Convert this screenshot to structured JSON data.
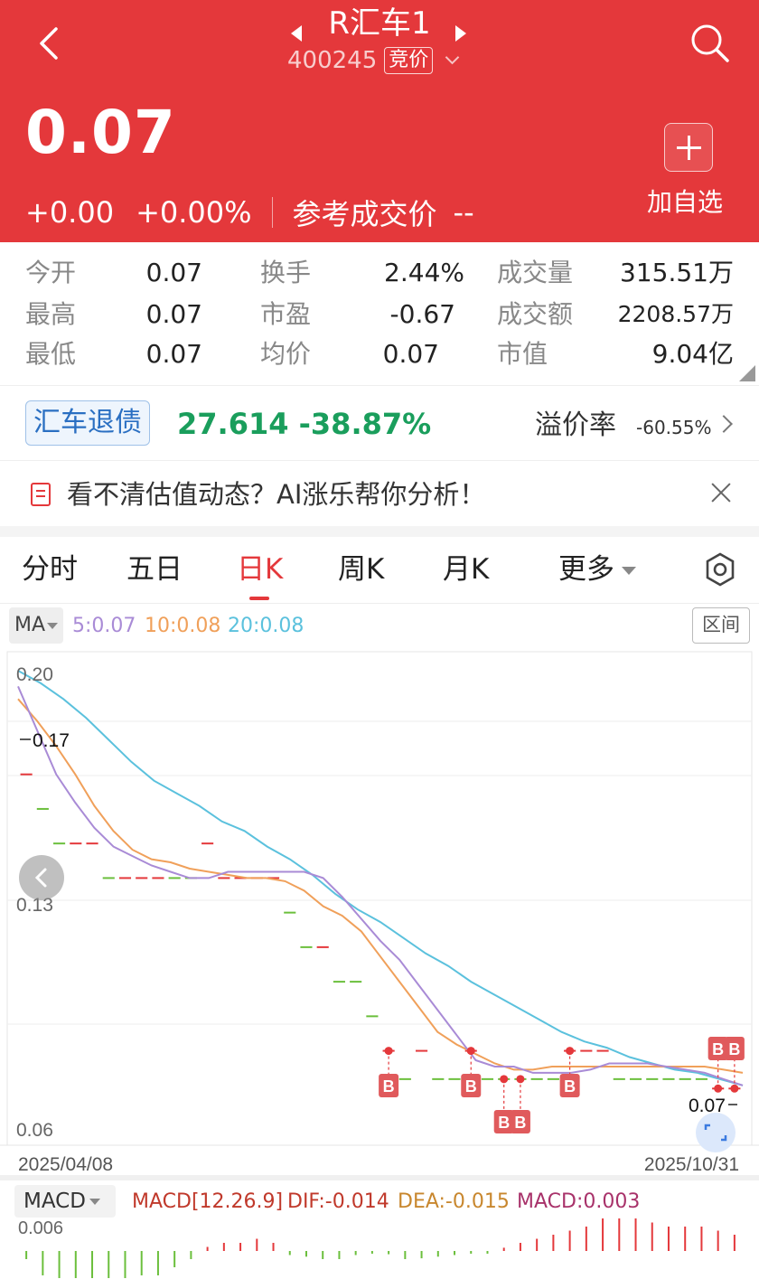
{
  "header": {
    "name": "R汇车1",
    "code": "400245",
    "code_tag": "竞价",
    "price": "0.07",
    "change": "+0.00",
    "change_pct": "+0.00%",
    "ref_label": "参考成交价",
    "ref_value": "--",
    "add_label": "加自选"
  },
  "stats": [
    {
      "label": "今开",
      "value": "0.07"
    },
    {
      "label": "换手",
      "value": "2.44%"
    },
    {
      "label": "成交量",
      "value": "315.51万"
    },
    {
      "label": "最高",
      "value": "0.07"
    },
    {
      "label": "市盈",
      "value": "-0.67"
    },
    {
      "label": "成交额",
      "value": "2208.57万"
    },
    {
      "label": "最低",
      "value": "0.07"
    },
    {
      "label": "均价",
      "value": "0.07"
    },
    {
      "label": "市值",
      "value": "9.04亿"
    }
  ],
  "bond": {
    "tag": "汇车退债",
    "value": "27.614 -38.87%",
    "premium_label": "溢价率",
    "premium_value": "-60.55%"
  },
  "ai_banner": {
    "text": "看不清估值动态？AI涨乐帮你分析！"
  },
  "tabs": [
    {
      "label": "分时"
    },
    {
      "label": "五日"
    },
    {
      "label": "日K"
    },
    {
      "label": "周K"
    },
    {
      "label": "月K"
    },
    {
      "label": "更多"
    }
  ],
  "active_tab": "日K",
  "ma_bar": {
    "button": "MA",
    "ma5": "5:0.07",
    "ma10": "10:0.08",
    "ma20": "20:0.08",
    "range_button": "区间"
  },
  "colors": {
    "header_red": "#e4383b",
    "ma5": "#a98bd6",
    "ma10": "#f0a05a",
    "ma20": "#5bc1dd",
    "up": "#e4383b",
    "down": "#6bbf3c",
    "bond_green": "#1a9e5c"
  },
  "chart_data": {
    "type": "candlestick",
    "y_ticks": [
      "0.20",
      "0.13",
      "0.06"
    ],
    "ylim": [
      0.06,
      0.205
    ],
    "x_start_label": "2025/04/08",
    "x_end_label": "2025/10/31",
    "max_label": "0.17",
    "min_label": "0.07",
    "candles": [
      {
        "price": 0.172,
        "dir": "up"
      },
      {
        "price": 0.161,
        "dir": "down"
      },
      {
        "price": 0.15,
        "dir": "down"
      },
      {
        "price": 0.15,
        "dir": "up"
      },
      {
        "price": 0.15,
        "dir": "up"
      },
      {
        "price": 0.139,
        "dir": "down"
      },
      {
        "price": 0.139,
        "dir": "up"
      },
      {
        "price": 0.139,
        "dir": "up"
      },
      {
        "price": 0.139,
        "dir": "up"
      },
      {
        "price": 0.139,
        "dir": "down"
      },
      {
        "price": 0.139,
        "dir": "down"
      },
      {
        "price": 0.15,
        "dir": "up"
      },
      {
        "price": 0.139,
        "dir": "up"
      },
      {
        "price": 0.139,
        "dir": "up"
      },
      {
        "price": 0.139,
        "dir": "up"
      },
      {
        "price": 0.139,
        "dir": "up"
      },
      {
        "price": 0.128,
        "dir": "down"
      },
      {
        "price": 0.117,
        "dir": "down"
      },
      {
        "price": 0.117,
        "dir": "up"
      },
      {
        "price": 0.106,
        "dir": "down"
      },
      {
        "price": 0.106,
        "dir": "down"
      },
      {
        "price": 0.095,
        "dir": "down"
      },
      {
        "price": 0.084,
        "dir": "up"
      },
      {
        "price": 0.075,
        "dir": "down"
      },
      {
        "price": 0.084,
        "dir": "up"
      },
      {
        "price": 0.075,
        "dir": "down"
      },
      {
        "price": 0.075,
        "dir": "down"
      },
      {
        "price": 0.084,
        "dir": "up"
      },
      {
        "price": 0.075,
        "dir": "down"
      },
      {
        "price": 0.075,
        "dir": "down"
      },
      {
        "price": 0.075,
        "dir": "down"
      },
      {
        "price": 0.075,
        "dir": "down"
      },
      {
        "price": 0.075,
        "dir": "down"
      },
      {
        "price": 0.084,
        "dir": "up"
      },
      {
        "price": 0.084,
        "dir": "up"
      },
      {
        "price": 0.084,
        "dir": "up"
      },
      {
        "price": 0.075,
        "dir": "down"
      },
      {
        "price": 0.075,
        "dir": "down"
      },
      {
        "price": 0.075,
        "dir": "down"
      },
      {
        "price": 0.075,
        "dir": "down"
      },
      {
        "price": 0.075,
        "dir": "down"
      },
      {
        "price": 0.075,
        "dir": "down"
      },
      {
        "price": 0.072,
        "dir": "up"
      },
      {
        "price": 0.072,
        "dir": "up"
      }
    ],
    "ma5": [
      0.2,
      0.186,
      0.172,
      0.163,
      0.155,
      0.149,
      0.146,
      0.143,
      0.141,
      0.139,
      0.139,
      0.141,
      0.141,
      0.141,
      0.141,
      0.141,
      0.139,
      0.133,
      0.126,
      0.119,
      0.113,
      0.105,
      0.097,
      0.089,
      0.081,
      0.079,
      0.079,
      0.077,
      0.077,
      0.077,
      0.078,
      0.08,
      0.08,
      0.08,
      0.079,
      0.078,
      0.077,
      0.075,
      0.073
    ],
    "ma10": [
      0.196,
      0.189,
      0.181,
      0.172,
      0.162,
      0.154,
      0.148,
      0.145,
      0.144,
      0.142,
      0.141,
      0.14,
      0.139,
      0.139,
      0.138,
      0.135,
      0.13,
      0.127,
      0.122,
      0.114,
      0.106,
      0.098,
      0.09,
      0.086,
      0.083,
      0.08,
      0.078,
      0.078,
      0.079,
      0.079,
      0.079,
      0.079,
      0.079,
      0.079,
      0.079,
      0.079,
      0.079,
      0.078,
      0.077
    ],
    "ma20": [
      0.205,
      0.201,
      0.196,
      0.19,
      0.183,
      0.176,
      0.17,
      0.166,
      0.162,
      0.157,
      0.154,
      0.149,
      0.145,
      0.14,
      0.134,
      0.129,
      0.125,
      0.12,
      0.115,
      0.111,
      0.106,
      0.102,
      0.098,
      0.094,
      0.09,
      0.087,
      0.085,
      0.082,
      0.08,
      0.078,
      0.077,
      0.075,
      0.073
    ],
    "b_marks": [
      {
        "index": 22,
        "price": 0.084,
        "level": 0
      },
      {
        "index": 27,
        "price": 0.084,
        "level": 0
      },
      {
        "index": 29,
        "price": 0.075,
        "level": 1
      },
      {
        "index": 30,
        "price": 0.075,
        "level": 1
      },
      {
        "index": 33,
        "price": 0.084,
        "level": 0
      },
      {
        "index": 42,
        "price": 0.072,
        "level": 2
      },
      {
        "index": 43,
        "price": 0.072,
        "level": 2
      }
    ],
    "macd": {
      "label": "MACD",
      "params": "MACD[12.26.9]",
      "dif": "DIF:-0.014",
      "dea": "DEA:-0.015",
      "macd": "MACD:0.003",
      "y_tick": "0.006",
      "bars": [
        -0.001,
        -0.003,
        -0.0035,
        -0.004,
        -0.004,
        -0.004,
        -0.004,
        -0.003,
        -0.003,
        -0.002,
        -0.001,
        0.0005,
        0.001,
        0.001,
        0.0015,
        0.001,
        -0.0005,
        -0.0007,
        -0.001,
        -0.001,
        -0.0005,
        -0.0003,
        -0.0004,
        -0.001,
        -0.0009,
        -0.0007,
        -0.0005,
        -0.0003,
        -0.0002,
        0.0004,
        0.001,
        0.0015,
        0.002,
        0.0025,
        0.003,
        0.004,
        0.004,
        0.004,
        0.0035,
        0.003,
        0.003,
        0.003,
        0.0025,
        0.002
      ]
    }
  }
}
